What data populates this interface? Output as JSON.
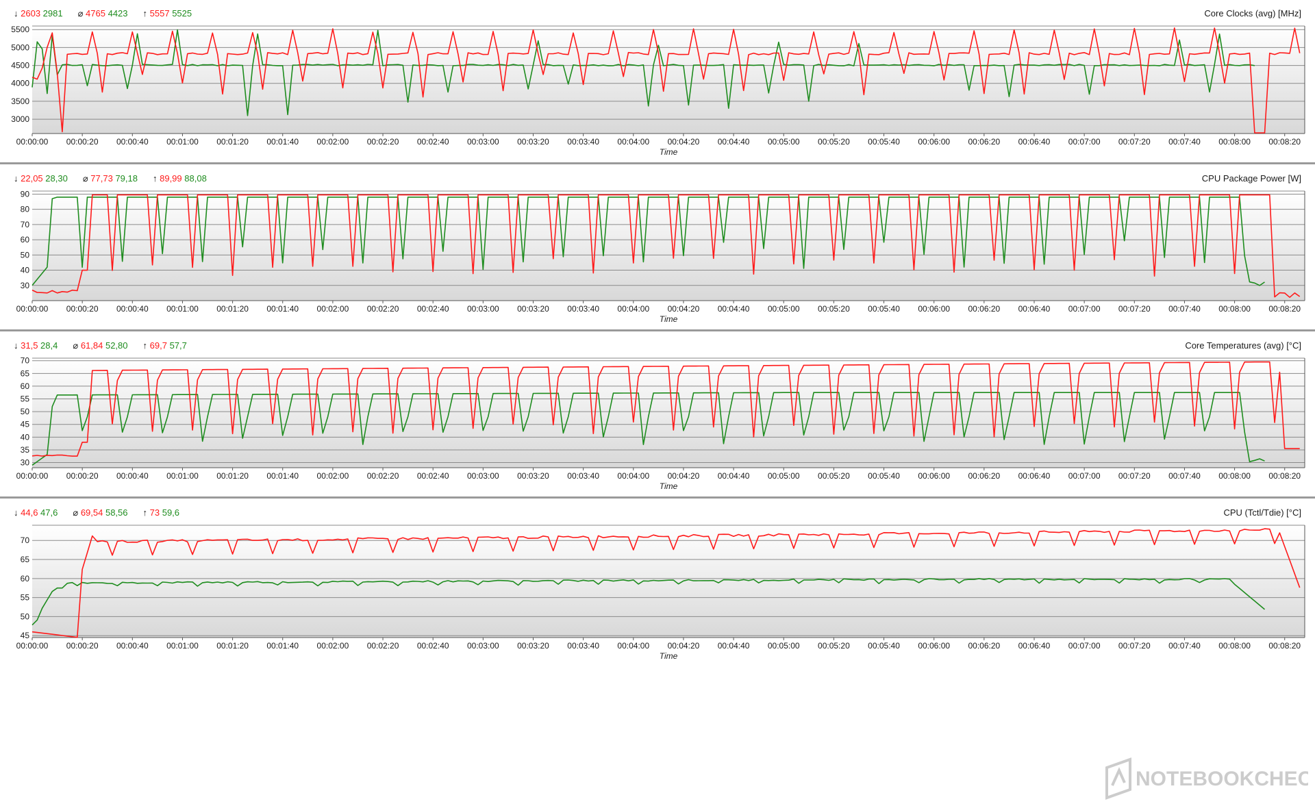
{
  "colors": {
    "red": "#ff1a1a",
    "green": "#1e8c1e",
    "grid": "#8a8a8a",
    "text": "#1a1a1a"
  },
  "x_ticks": [
    "00:00:00",
    "00:00:20",
    "00:00:40",
    "00:01:00",
    "00:01:20",
    "00:01:40",
    "00:02:00",
    "00:02:20",
    "00:02:40",
    "00:03:00",
    "00:03:20",
    "00:03:40",
    "00:04:00",
    "00:04:20",
    "00:04:40",
    "00:05:00",
    "00:05:20",
    "00:05:40",
    "00:06:00",
    "00:06:20",
    "00:06:40",
    "00:07:00",
    "00:07:20",
    "00:07:40",
    "00:08:00",
    "00:08:20"
  ],
  "xlabel": "Time",
  "watermark": "NOTEBOOKCHECK",
  "chart_data": [
    {
      "type": "line",
      "title": "Core Clocks (avg) [MHz]",
      "stats": {
        "min": "2603",
        "min2": "2981",
        "avg": "4765",
        "avg2": "4423",
        "max": "5557",
        "max2": "5525"
      },
      "ylim": [
        2600,
        5600
      ],
      "yticks": [
        3000,
        3500,
        4000,
        4500,
        5000,
        5500
      ],
      "x_range_s": [
        0,
        508
      ],
      "pattern": "clock"
    },
    {
      "type": "line",
      "title": "CPU Package Power [W]",
      "stats": {
        "min": "22,05",
        "min2": "28,30",
        "avg": "77,73",
        "avg2": "79,18",
        "max": "89,99",
        "max2": "88,08"
      },
      "ylim": [
        20,
        92
      ],
      "yticks": [
        30,
        40,
        50,
        60,
        70,
        80,
        90
      ],
      "x_range_s": [
        0,
        508
      ],
      "pattern": "power"
    },
    {
      "type": "line",
      "title": "Core Temperatures (avg) [°C]",
      "stats": {
        "min": "31,5",
        "min2": "28,4",
        "avg": "61,84",
        "avg2": "52,80",
        "max": "69,7",
        "max2": "57,7"
      },
      "ylim": [
        28,
        71
      ],
      "yticks": [
        30,
        35,
        40,
        45,
        50,
        55,
        60,
        65,
        70
      ],
      "x_range_s": [
        0,
        508
      ],
      "pattern": "coretemp"
    },
    {
      "type": "line",
      "title": "CPU (Tctl/Tdie) [°C]",
      "stats": {
        "min": "44,6",
        "min2": "47,6",
        "avg": "69,54",
        "avg2": "58,56",
        "max": "73",
        "max2": "59,6"
      },
      "ylim": [
        44.5,
        74
      ],
      "yticks": [
        45,
        50,
        55,
        60,
        65,
        70
      ],
      "x_range_s": [
        0,
        508
      ],
      "pattern": "tctl"
    }
  ]
}
